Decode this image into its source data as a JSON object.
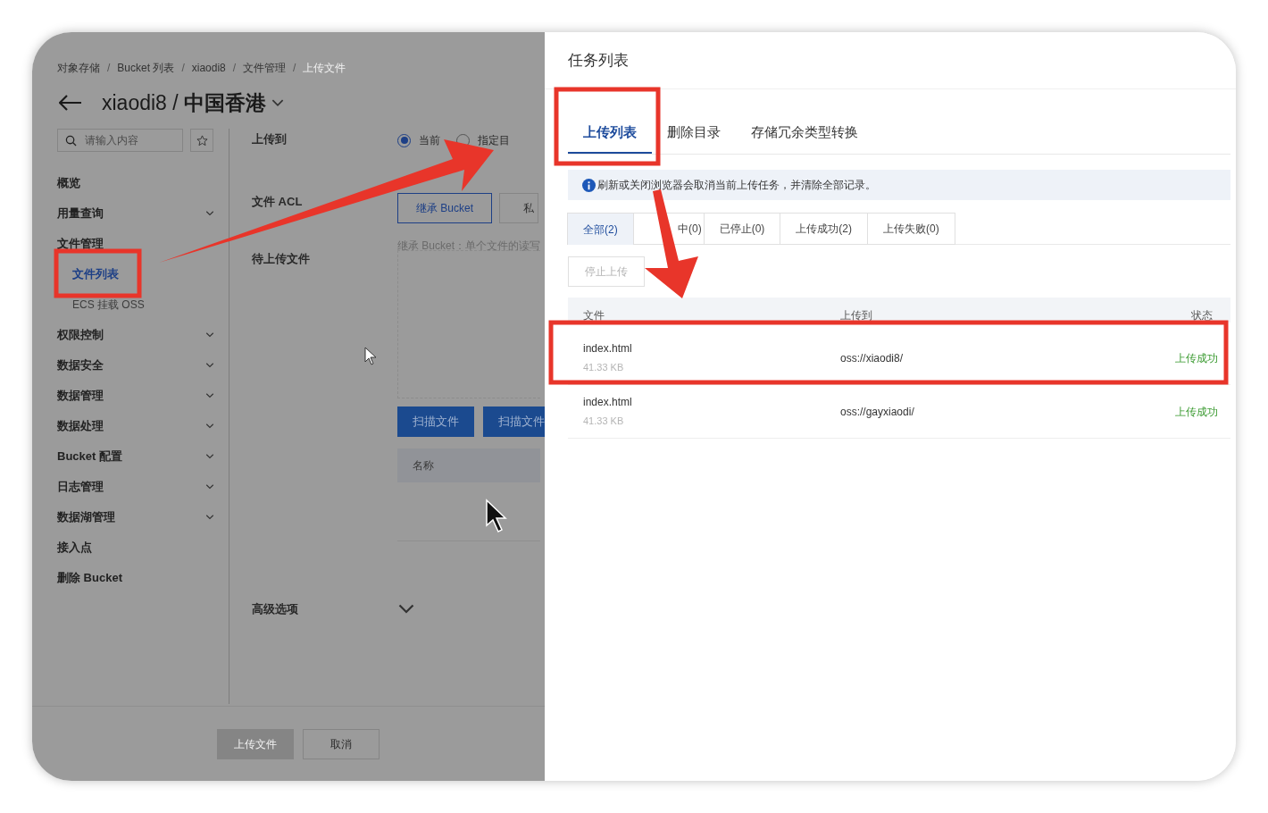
{
  "breadcrumb": [
    {
      "kind": "link",
      "label": "对象存储",
      "current": false
    },
    {
      "kind": "separator",
      "label": "/"
    },
    {
      "kind": "link",
      "label": "Bucket 列表",
      "current": false
    },
    {
      "kind": "separator",
      "label": "/"
    },
    {
      "kind": "link",
      "label": "xiaodi8",
      "current": false
    },
    {
      "kind": "separator",
      "label": "/"
    },
    {
      "kind": "link",
      "label": "文件管理",
      "current": false
    },
    {
      "kind": "separator",
      "label": "/"
    },
    {
      "kind": "link",
      "label": "上传文件",
      "current": true
    }
  ],
  "header": {
    "title": "xiaodi8 / **中国香港**"
  },
  "sidebar": {
    "search_placeholder": "请输入内容",
    "items": [
      {
        "label": "概览",
        "expandable": false
      },
      {
        "label": "用量查询",
        "expandable": true
      },
      {
        "label": "文件管理",
        "expandable": false,
        "children": [
          {
            "label": "文件列表",
            "selected": true
          },
          {
            "label": "ECS 挂载 OSS",
            "selected": false
          }
        ]
      },
      {
        "label": "权限控制",
        "expandable": true
      },
      {
        "label": "数据安全",
        "expandable": true
      },
      {
        "label": "数据管理",
        "expandable": true
      },
      {
        "label": "数据处理",
        "expandable": true
      },
      {
        "label": "Bucket 配置",
        "expandable": true
      },
      {
        "label": "日志管理",
        "expandable": true
      },
      {
        "label": "数据湖管理",
        "expandable": true
      },
      {
        "label": "接入点",
        "expandable": false
      },
      {
        "label": "删除 Bucket",
        "expandable": false
      }
    ]
  },
  "form": {
    "upload_to": {
      "label": "上传到",
      "options": [
        {
          "label": "当前",
          "selected": true
        },
        {
          "label": "指定目",
          "selected": false
        }
      ]
    },
    "acl": {
      "label": "文件 ACL",
      "options": [
        {
          "label": "继承 Bucket",
          "selected": true
        },
        {
          "label": "私",
          "selected": false
        }
      ],
      "hint": "继承 Bucket：单个文件的读写"
    },
    "files": {
      "label": "待上传文件",
      "buttons": [
        "扫描文件",
        "扫描文件"
      ],
      "column": "名称"
    },
    "advanced": {
      "label": "高级选项"
    }
  },
  "footer": {
    "buttons": [
      {
        "label": "上传文件",
        "disabled": true
      },
      {
        "label": "取消",
        "disabled": false
      }
    ]
  },
  "drawer": {
    "title": "任务列表",
    "tabs": [
      {
        "label": "上传列表",
        "selected": true
      },
      {
        "label": "删除目录",
        "selected": false
      },
      {
        "label": "存储冗余类型转换",
        "selected": false
      }
    ],
    "notice": "刷新或关闭浏览器会取消当前上传任务，并清除全部记录。",
    "filters": [
      {
        "label": "全部(2)",
        "selected": true
      },
      {
        "label": "中(0)",
        "selected": false
      },
      {
        "label": "已停止(0)",
        "selected": false
      },
      {
        "label": "上传成功(2)",
        "selected": false
      },
      {
        "label": "上传失败(0)",
        "selected": false
      }
    ],
    "stop_button": {
      "label": "停止上传",
      "disabled": true
    },
    "table": {
      "columns": [
        "文件",
        "上传到",
        "状态"
      ],
      "rows": [
        {
          "file": "index.html",
          "size": "41.33 KB",
          "target": "oss://xiaodi8/",
          "status": "上传成功"
        },
        {
          "file": "index.html",
          "size": "41.33 KB",
          "target": "oss://gayxiaodi/",
          "status": "上传成功"
        }
      ]
    }
  }
}
